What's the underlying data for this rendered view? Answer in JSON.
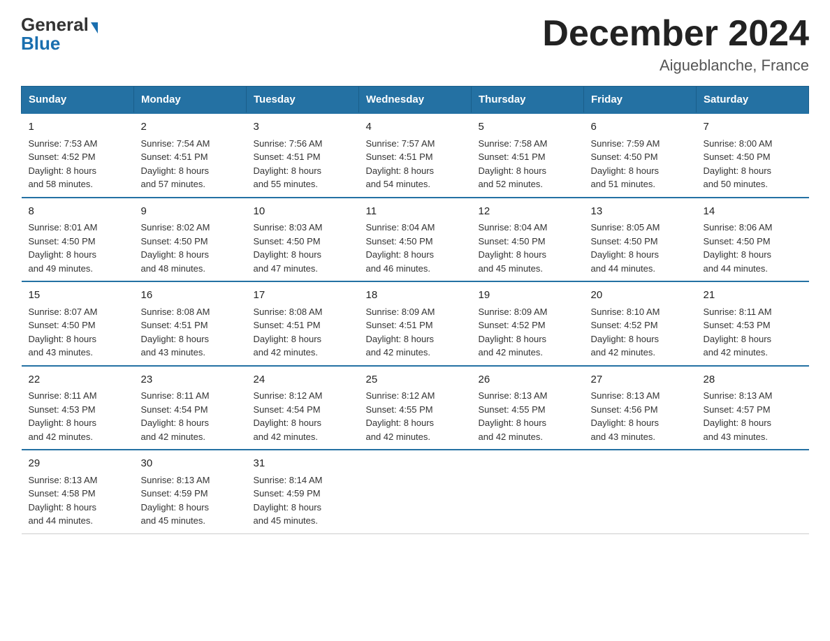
{
  "header": {
    "logo_line1": "General",
    "logo_line2": "Blue",
    "title": "December 2024",
    "subtitle": "Aigueblanche, France"
  },
  "days_of_week": [
    "Sunday",
    "Monday",
    "Tuesday",
    "Wednesday",
    "Thursday",
    "Friday",
    "Saturday"
  ],
  "weeks": [
    [
      {
        "day": "1",
        "sunrise": "7:53 AM",
        "sunset": "4:52 PM",
        "daylight": "8 hours and 58 minutes."
      },
      {
        "day": "2",
        "sunrise": "7:54 AM",
        "sunset": "4:51 PM",
        "daylight": "8 hours and 57 minutes."
      },
      {
        "day": "3",
        "sunrise": "7:56 AM",
        "sunset": "4:51 PM",
        "daylight": "8 hours and 55 minutes."
      },
      {
        "day": "4",
        "sunrise": "7:57 AM",
        "sunset": "4:51 PM",
        "daylight": "8 hours and 54 minutes."
      },
      {
        "day": "5",
        "sunrise": "7:58 AM",
        "sunset": "4:51 PM",
        "daylight": "8 hours and 52 minutes."
      },
      {
        "day": "6",
        "sunrise": "7:59 AM",
        "sunset": "4:50 PM",
        "daylight": "8 hours and 51 minutes."
      },
      {
        "day": "7",
        "sunrise": "8:00 AM",
        "sunset": "4:50 PM",
        "daylight": "8 hours and 50 minutes."
      }
    ],
    [
      {
        "day": "8",
        "sunrise": "8:01 AM",
        "sunset": "4:50 PM",
        "daylight": "8 hours and 49 minutes."
      },
      {
        "day": "9",
        "sunrise": "8:02 AM",
        "sunset": "4:50 PM",
        "daylight": "8 hours and 48 minutes."
      },
      {
        "day": "10",
        "sunrise": "8:03 AM",
        "sunset": "4:50 PM",
        "daylight": "8 hours and 47 minutes."
      },
      {
        "day": "11",
        "sunrise": "8:04 AM",
        "sunset": "4:50 PM",
        "daylight": "8 hours and 46 minutes."
      },
      {
        "day": "12",
        "sunrise": "8:04 AM",
        "sunset": "4:50 PM",
        "daylight": "8 hours and 45 minutes."
      },
      {
        "day": "13",
        "sunrise": "8:05 AM",
        "sunset": "4:50 PM",
        "daylight": "8 hours and 44 minutes."
      },
      {
        "day": "14",
        "sunrise": "8:06 AM",
        "sunset": "4:50 PM",
        "daylight": "8 hours and 44 minutes."
      }
    ],
    [
      {
        "day": "15",
        "sunrise": "8:07 AM",
        "sunset": "4:50 PM",
        "daylight": "8 hours and 43 minutes."
      },
      {
        "day": "16",
        "sunrise": "8:08 AM",
        "sunset": "4:51 PM",
        "daylight": "8 hours and 43 minutes."
      },
      {
        "day": "17",
        "sunrise": "8:08 AM",
        "sunset": "4:51 PM",
        "daylight": "8 hours and 42 minutes."
      },
      {
        "day": "18",
        "sunrise": "8:09 AM",
        "sunset": "4:51 PM",
        "daylight": "8 hours and 42 minutes."
      },
      {
        "day": "19",
        "sunrise": "8:09 AM",
        "sunset": "4:52 PM",
        "daylight": "8 hours and 42 minutes."
      },
      {
        "day": "20",
        "sunrise": "8:10 AM",
        "sunset": "4:52 PM",
        "daylight": "8 hours and 42 minutes."
      },
      {
        "day": "21",
        "sunrise": "8:11 AM",
        "sunset": "4:53 PM",
        "daylight": "8 hours and 42 minutes."
      }
    ],
    [
      {
        "day": "22",
        "sunrise": "8:11 AM",
        "sunset": "4:53 PM",
        "daylight": "8 hours and 42 minutes."
      },
      {
        "day": "23",
        "sunrise": "8:11 AM",
        "sunset": "4:54 PM",
        "daylight": "8 hours and 42 minutes."
      },
      {
        "day": "24",
        "sunrise": "8:12 AM",
        "sunset": "4:54 PM",
        "daylight": "8 hours and 42 minutes."
      },
      {
        "day": "25",
        "sunrise": "8:12 AM",
        "sunset": "4:55 PM",
        "daylight": "8 hours and 42 minutes."
      },
      {
        "day": "26",
        "sunrise": "8:13 AM",
        "sunset": "4:55 PM",
        "daylight": "8 hours and 42 minutes."
      },
      {
        "day": "27",
        "sunrise": "8:13 AM",
        "sunset": "4:56 PM",
        "daylight": "8 hours and 43 minutes."
      },
      {
        "day": "28",
        "sunrise": "8:13 AM",
        "sunset": "4:57 PM",
        "daylight": "8 hours and 43 minutes."
      }
    ],
    [
      {
        "day": "29",
        "sunrise": "8:13 AM",
        "sunset": "4:58 PM",
        "daylight": "8 hours and 44 minutes."
      },
      {
        "day": "30",
        "sunrise": "8:13 AM",
        "sunset": "4:59 PM",
        "daylight": "8 hours and 45 minutes."
      },
      {
        "day": "31",
        "sunrise": "8:14 AM",
        "sunset": "4:59 PM",
        "daylight": "8 hours and 45 minutes."
      },
      null,
      null,
      null,
      null
    ]
  ],
  "labels": {
    "sunrise": "Sunrise:",
    "sunset": "Sunset:",
    "daylight": "Daylight:"
  }
}
